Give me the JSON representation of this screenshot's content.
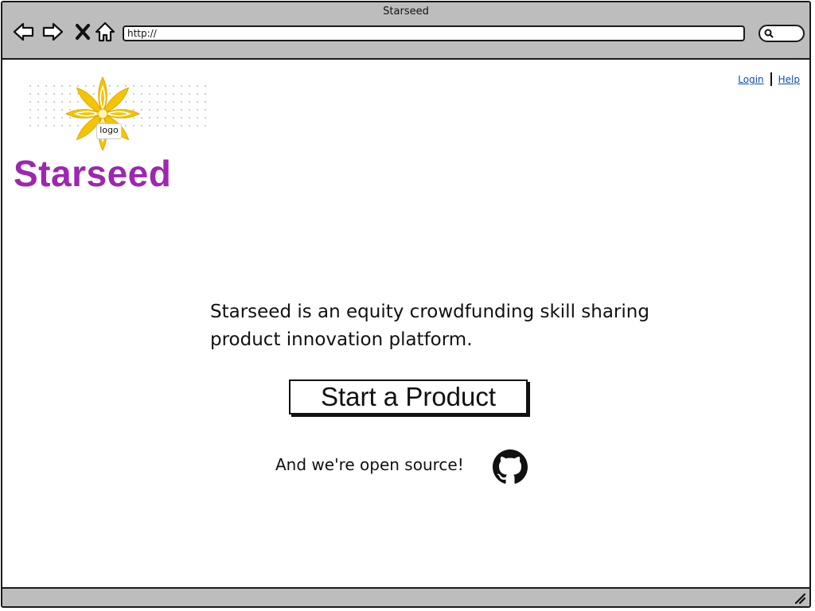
{
  "window": {
    "title": "Starseed"
  },
  "toolbar": {
    "back_icon": "back-arrow-icon",
    "forward_icon": "forward-arrow-icon",
    "stop_icon": "close-icon",
    "home_icon": "home-icon",
    "address": "http://",
    "search_icon": "search-icon"
  },
  "header": {
    "logo_tag": "logo",
    "brand_name": "Starseed",
    "links": [
      {
        "label": "Login"
      },
      {
        "label": "Help"
      }
    ]
  },
  "main": {
    "tagline": "Starseed is an equity crowdfunding skill sharing product innovation platform.",
    "cta_label": "Start a Product",
    "open_source_text": "And we're open source!",
    "github_icon": "github-icon"
  },
  "colors": {
    "brand": "#9c27b0",
    "logo_flower": "#f5c400",
    "link": "#0b4fa8",
    "chrome": "#bdbdbd"
  }
}
